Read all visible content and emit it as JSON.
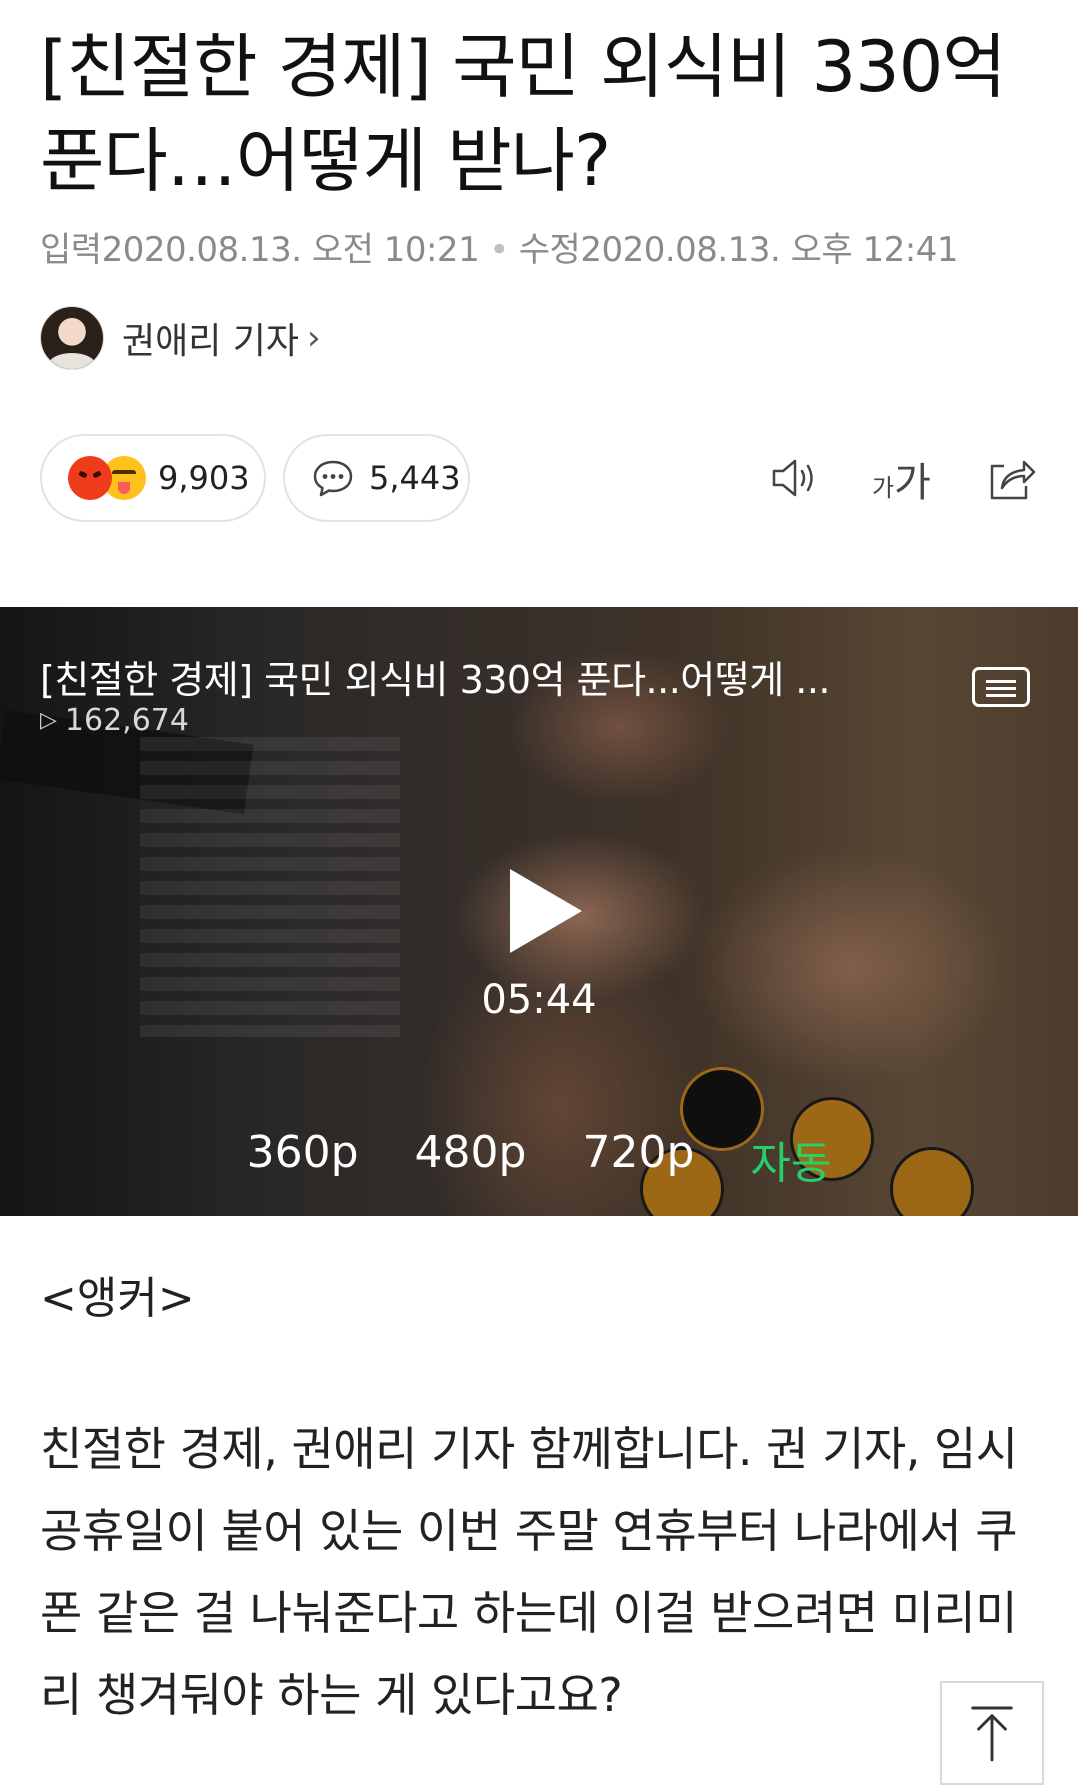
{
  "article": {
    "title": "[친절한 경제] 국민 외식비 330억 푼다…어떻게 받나?",
    "input_label": "입력",
    "input_time": "2020.08.13. 오전 10:21",
    "edit_label": "수정",
    "edit_time": "2020.08.13. 오후 12:41",
    "author": "권애리 기자",
    "author_chevron": "›"
  },
  "actions": {
    "reaction_count": "9,903",
    "comment_count": "5,443",
    "font_size_small": "가",
    "font_size_large": "가",
    "icons": [
      "speaker-icon",
      "font-size-icon",
      "share-icon",
      "comment-icon"
    ]
  },
  "video": {
    "title": "[친절한 경제] 국민 외식비 330억 푼다...어떻게 ...",
    "views": "162,674",
    "duration": "05:44",
    "qualities": [
      "360p",
      "480p",
      "720p",
      "자동"
    ],
    "active_quality": "자동",
    "active_color": "#27d06a"
  },
  "content": {
    "section_label": "<앵커>",
    "paragraph": "친절한 경제, 권애리 기자 함께합니다. 권 기자, 임시공휴일이 붙어 있는 이번 주말 연휴부터 나라에서 쿠폰 같은 걸 나눠준다고 하는데 이걸 받으려면 미리미리 챙겨둬야 하는 게 있다고요?"
  }
}
